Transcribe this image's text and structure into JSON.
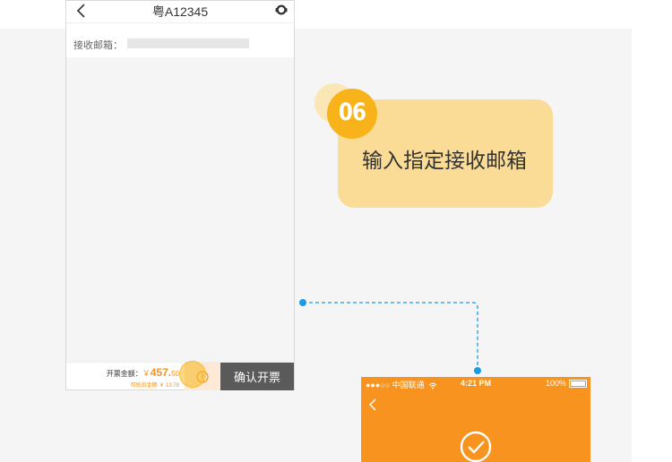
{
  "phone1": {
    "nav_title": "粤A12345",
    "email_label": "接收邮箱：",
    "email_value": "",
    "amount_label": "开票金额：",
    "currency": "￥",
    "amount_int": "457.",
    "amount_dec": "50",
    "deduct_label": "可抵扣金额",
    "deduct_value": "￥ 13.78",
    "confirm_label": "确认开票"
  },
  "callout": {
    "step": "06",
    "text": "输入指定接收邮箱"
  },
  "phone2": {
    "carrier": "●●●○○ 中国联通",
    "time": "4:21 PM",
    "battery": "100%"
  },
  "colors": {
    "accent_orange": "#f7931e",
    "badge_yellow": "#f8b31a",
    "callout_bg": "#fbdc97",
    "connector_blue": "#1b9be6",
    "button_dark": "#5a5a5a"
  }
}
